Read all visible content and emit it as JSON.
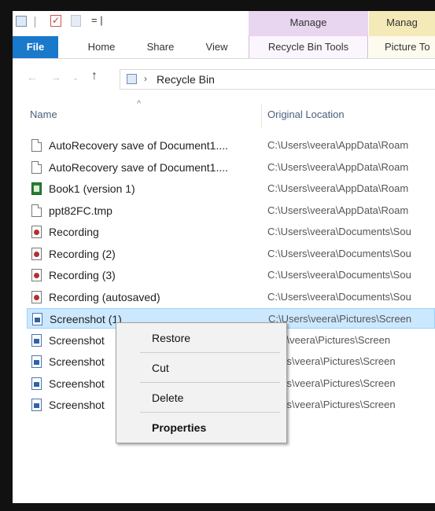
{
  "ribbon": {
    "contextual_groups": [
      "Manage",
      "Manag"
    ],
    "tabs": {
      "file": "File",
      "home": "Home",
      "share": "Share",
      "view": "View",
      "recycle_bin_tools": "Recycle Bin Tools",
      "picture_tools": "Picture To"
    },
    "qat_arrow": "= |"
  },
  "navigation": {
    "back_icon": "back-arrow-icon",
    "forward_icon": "forward-arrow-icon",
    "up_icon": "up-arrow-icon",
    "breadcrumb_chevron": "›",
    "location": "Recycle Bin"
  },
  "columns": {
    "name": "Name",
    "original_location": "Original Location"
  },
  "files": [
    {
      "name": "AutoRecovery save of Document1....",
      "location": "C:\\Users\\veera\\AppData\\Roam",
      "icon": "document-icon",
      "type": "doc"
    },
    {
      "name": "AutoRecovery save of Document1....",
      "location": "C:\\Users\\veera\\AppData\\Roam",
      "icon": "document-icon",
      "type": "doc"
    },
    {
      "name": "Book1 (version 1)",
      "location": "C:\\Users\\veera\\AppData\\Roam",
      "icon": "excel-icon",
      "type": "xls"
    },
    {
      "name": "ppt82FC.tmp",
      "location": "C:\\Users\\veera\\AppData\\Roam",
      "icon": "document-icon",
      "type": "doc"
    },
    {
      "name": "Recording",
      "location": "C:\\Users\\veera\\Documents\\Sou",
      "icon": "recording-icon",
      "type": "rec"
    },
    {
      "name": "Recording (2)",
      "location": "C:\\Users\\veera\\Documents\\Sou",
      "icon": "recording-icon",
      "type": "rec"
    },
    {
      "name": "Recording (3)",
      "location": "C:\\Users\\veera\\Documents\\Sou",
      "icon": "recording-icon",
      "type": "rec"
    },
    {
      "name": "Recording (autosaved)",
      "location": "C:\\Users\\veera\\Documents\\Sou",
      "icon": "recording-icon",
      "type": "rec"
    },
    {
      "name": "Screenshot (1)",
      "location": "C:\\Users\\veera\\Pictures\\Screen",
      "icon": "image-icon",
      "type": "img",
      "selected": true
    },
    {
      "name": "Screenshot",
      "location": "sers\\veera\\Pictures\\Screen",
      "icon": "image-icon",
      "type": "img"
    },
    {
      "name": "Screenshot",
      "location": "Jsers\\veera\\Pictures\\Screen",
      "icon": "image-icon",
      "type": "img"
    },
    {
      "name": "Screenshot",
      "location": "Jsers\\veera\\Pictures\\Screen",
      "icon": "image-icon",
      "type": "img"
    },
    {
      "name": "Screenshot",
      "location": "Jsers\\veera\\Pictures\\Screen",
      "icon": "image-icon",
      "type": "img"
    }
  ],
  "context_menu": {
    "items": [
      "Restore",
      "Cut",
      "Delete",
      "Properties"
    ]
  },
  "colors": {
    "file_tab": "#1979ca",
    "manage_recycle": "#e8d5ef",
    "manage_picture": "#f4eab8",
    "selection": "#cce8ff"
  }
}
